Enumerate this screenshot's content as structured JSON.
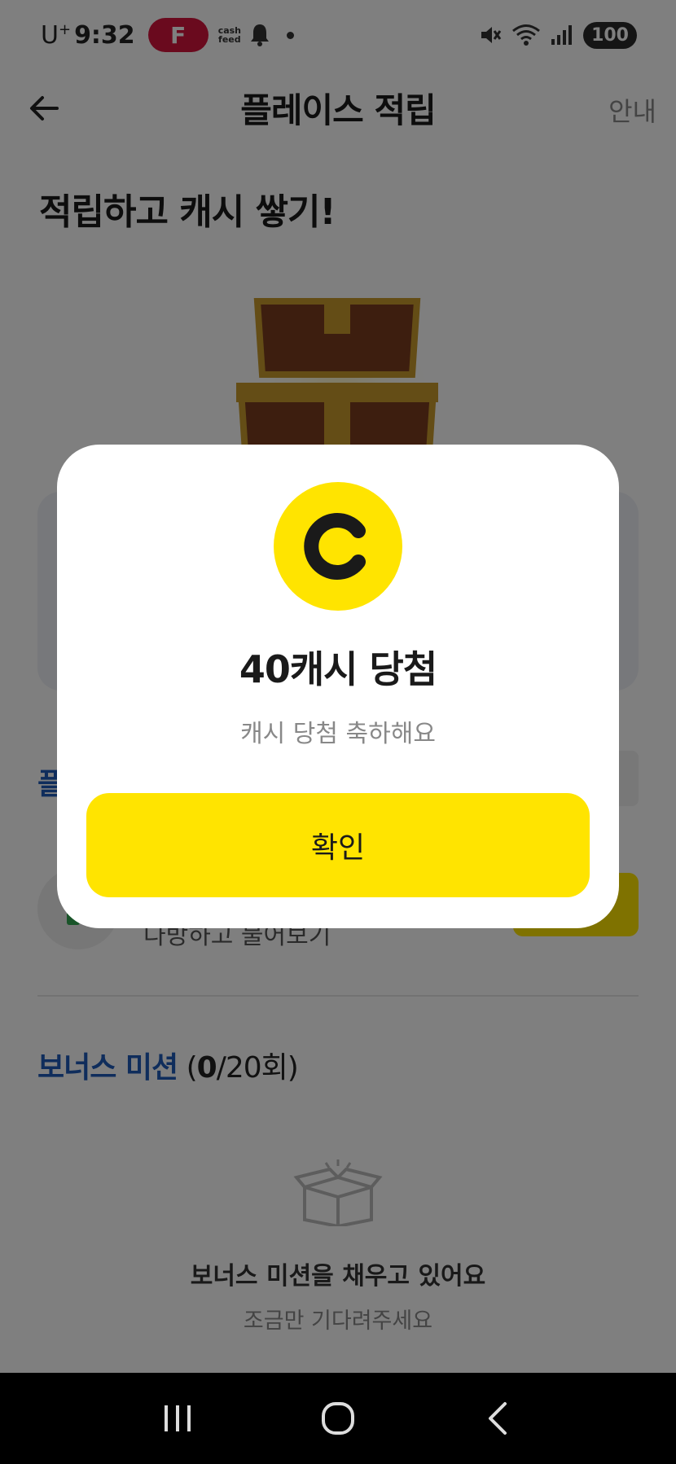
{
  "status_bar": {
    "carrier": "U",
    "carrier_sup": "+",
    "time": "9:32",
    "app_badge": "F",
    "cashfeed_top": "cash",
    "cashfeed_bottom": "feed",
    "battery": "100"
  },
  "header": {
    "title": "플레이스 적립",
    "guide_label": "안내",
    "back_icon": "arrow-left-icon"
  },
  "headline": "적립하고 캐시 쌓기!",
  "background": {
    "section_peek": "플",
    "list_peek_text": "다방하고 불어보기"
  },
  "bonus": {
    "name": "보너스 미션",
    "open_paren": " (",
    "count_done": "0",
    "count_total": "/20회)",
    "empty_title": "보너스 미션을 채우고 있어요",
    "empty_sub": "조금만 기다려주세요"
  },
  "modal": {
    "coin_icon": "cash-coin-icon",
    "title": "40캐시 당첨",
    "subtitle": "캐시 당첨 축하해요",
    "confirm_label": "확인"
  },
  "colors": {
    "accent_yellow": "#ffe400",
    "link_blue": "#1e5bb8",
    "badge_red": "#d4143c"
  }
}
